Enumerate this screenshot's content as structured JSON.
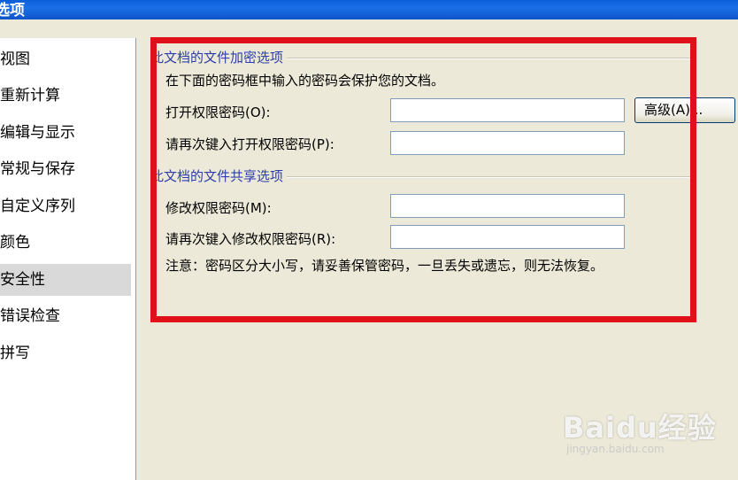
{
  "window": {
    "title": "选项"
  },
  "sidebar": {
    "items": [
      {
        "label": "视图",
        "selected": false
      },
      {
        "label": "重新计算",
        "selected": false
      },
      {
        "label": "编辑与显示",
        "selected": false
      },
      {
        "label": "常规与保存",
        "selected": false
      },
      {
        "label": "自定义序列",
        "selected": false
      },
      {
        "label": "颜色",
        "selected": false
      },
      {
        "label": "安全性",
        "selected": true
      },
      {
        "label": "错误检查",
        "selected": false
      },
      {
        "label": "拼写",
        "selected": false
      }
    ]
  },
  "encryption": {
    "legend": "此文档的文件加密选项",
    "description": "在下面的密码框中输入的密码会保护您的文档。",
    "open_password_label": "打开权限密码(O):",
    "open_password_value": "",
    "confirm_open_label": "请再次键入打开权限密码(P):",
    "confirm_open_value": "",
    "advanced_button": "高级(A)..."
  },
  "sharing": {
    "legend": "此文档的文件共享选项",
    "modify_password_label": "修改权限密码(M):",
    "modify_password_value": "",
    "confirm_modify_label": "请再次键入修改权限密码(R):",
    "confirm_modify_value": "",
    "note": "注意：密码区分大小写，请妥善保管密码，一旦丢失或遗忘，则无法恢复。"
  },
  "watermark": {
    "logo": "Baidu经验",
    "url": "jingyan.baidu.com"
  },
  "colors": {
    "highlight": "#e0101a",
    "legend": "#2d3ea8",
    "titlebar": "#0a5fd8"
  }
}
